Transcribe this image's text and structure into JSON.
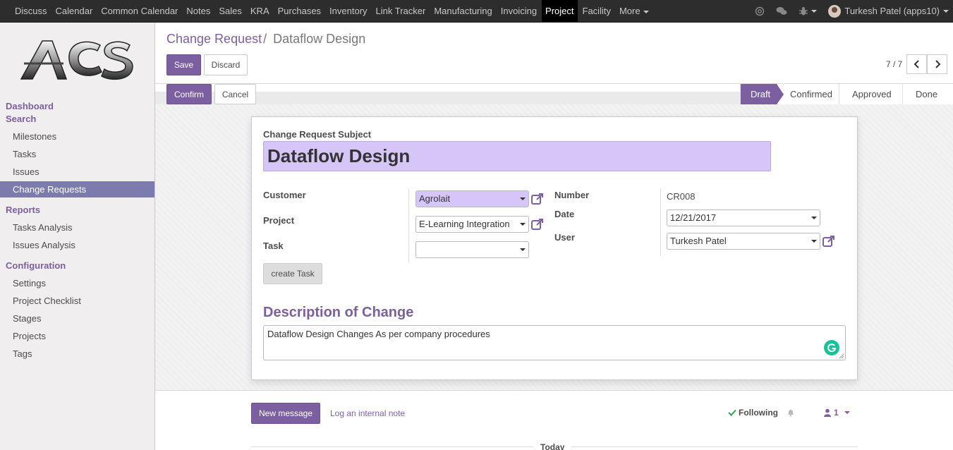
{
  "topbar": {
    "menu": [
      "Discuss",
      "Calendar",
      "Common Calendar",
      "Notes",
      "Sales",
      "KRA",
      "Purchases",
      "Inventory",
      "Link Tracker",
      "Manufacturing",
      "Invoicing",
      "Project",
      "Facility",
      "More"
    ],
    "active": "Project",
    "user": "Turkesh Patel (apps10)"
  },
  "sidebar": {
    "logo_text": "ACS",
    "dashboard": "Dashboard",
    "search": "Search",
    "search_items": [
      "Milestones",
      "Tasks",
      "Issues",
      "Change Requests"
    ],
    "active_item": "Change Requests",
    "reports": "Reports",
    "report_items": [
      "Tasks Analysis",
      "Issues Analysis"
    ],
    "configuration": "Configuration",
    "config_items": [
      "Settings",
      "Project Checklist",
      "Stages",
      "Projects",
      "Tags"
    ]
  },
  "control_panel": {
    "breadcrumb_parent": "Change Request",
    "breadcrumb_sep": "/",
    "breadcrumb_current": "Dataflow Design",
    "save_label": "Save",
    "discard_label": "Discard",
    "pager": "7 / 7"
  },
  "statusbar": {
    "confirm_label": "Confirm",
    "cancel_label": "Cancel",
    "stages": [
      "Draft",
      "Confirmed",
      "Approved",
      "Done"
    ],
    "active_stage": "Draft"
  },
  "form": {
    "subject_label": "Change Request Subject",
    "subject_value": "Dataflow Design",
    "customer_label": "Customer",
    "customer_value": "Agrolait",
    "project_label": "Project",
    "project_value": "E-Learning Integration",
    "task_label": "Task",
    "task_value": "",
    "create_task_label": "create Task",
    "number_label": "Number",
    "number_value": "CR008",
    "date_label": "Date",
    "date_value": "12/21/2017",
    "user_label": "User",
    "user_value": "Turkesh Patel",
    "description_heading": "Description of Change",
    "description_value": "Dataflow Design Changes As per company procedures"
  },
  "chatter": {
    "new_message_label": "New message",
    "log_note_label": "Log an internal note",
    "following_label": "Following",
    "followers_count": "1",
    "today_label": "Today"
  },
  "colors": {
    "accent": "#7c5fa0",
    "highlight_field": "#d6c6f7",
    "topbar": "#2d2d2d"
  }
}
